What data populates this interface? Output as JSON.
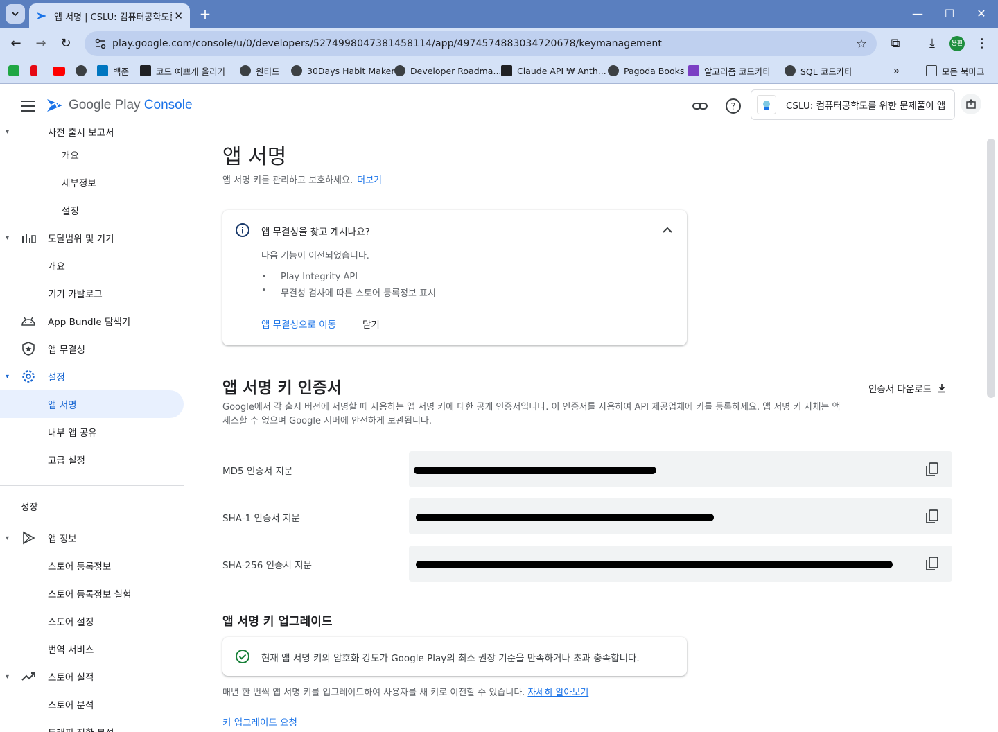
{
  "browser": {
    "tab_title": "앱 서명 | CSLU: 컴퓨터공학도를",
    "url": "play.google.com/console/u/0/developers/5274998047381458114/app/4974574883034720678/keymanagement",
    "profile_label": "용환",
    "bookmarks": [
      {
        "label": "",
        "icon_color": "#20a744"
      },
      {
        "label": "",
        "icon_color": "#e50914"
      },
      {
        "label": "",
        "icon_color": "#ff0000"
      },
      {
        "label": "",
        "icon_color": "#3c4043"
      },
      {
        "label": "백준",
        "icon_color": "#0076c0"
      },
      {
        "label": "코드 예쁘게 올리기",
        "icon_color": "#202124"
      },
      {
        "label": "원티드",
        "icon_color": "#3c4043"
      },
      {
        "label": "30Days Habit Maker",
        "icon_color": "#3c4043"
      },
      {
        "label": "Developer Roadma...",
        "icon_color": "#3c4043"
      },
      {
        "label": "Claude API ₩ Anth...",
        "icon_color": "#202124"
      },
      {
        "label": "Pagoda Books",
        "icon_color": "#3c4043"
      },
      {
        "label": "알고리즘 코드카타",
        "icon_color": "#7b3fc4"
      },
      {
        "label": "SQL 코드카타",
        "icon_color": "#3c4043"
      }
    ],
    "all_bookmarks": "모든 북마크"
  },
  "header": {
    "brand_google_play": "Google Play",
    "brand_console": "Console",
    "app_name": "CSLU: 컴퓨터공학도를 위한 문제풀이 앱"
  },
  "sidebar": {
    "partial_top": "사전 출시 보고서",
    "items": [
      {
        "label": "개요",
        "level": 2
      },
      {
        "label": "세부정보",
        "level": 2
      },
      {
        "label": "설정",
        "level": 2
      },
      {
        "label": "도달범위 및 기기",
        "level": 1,
        "icon": "bar-chart-icon"
      },
      {
        "label": "개요",
        "level": 2
      },
      {
        "label": "기기 카탈로그",
        "level": 2
      },
      {
        "label": "App Bundle 탐색기",
        "level": 1,
        "icon": "android-icon"
      },
      {
        "label": "앱 무결성",
        "level": 1,
        "icon": "shield-icon"
      },
      {
        "label": "설정",
        "level": 1,
        "icon": "gear-icon"
      },
      {
        "label": "앱 서명",
        "level": 2
      },
      {
        "label": "내부 앱 공유",
        "level": 2
      },
      {
        "label": "고급 설정",
        "level": 2
      }
    ],
    "section_growth": "성장",
    "growth_items": [
      {
        "label": "앱 정보",
        "icon": "play-icon"
      },
      {
        "label": "스토어 등록정보"
      },
      {
        "label": "스토어 등록정보 실험"
      },
      {
        "label": "스토어 설정"
      },
      {
        "label": "번역 서비스"
      },
      {
        "label": "스토어 실적",
        "icon": "trending-icon"
      },
      {
        "label": "스토어 분석"
      },
      {
        "label": "트래픽 전환 분석"
      }
    ]
  },
  "main": {
    "title": "앱 서명",
    "subtitle": "앱 서명 키를 관리하고 보호하세요.",
    "learn_more": "더보기",
    "info_card": {
      "title": "앱 무결성을 찾고 계시나요?",
      "body": "다음 기능이 이전되었습니다.",
      "bullets": [
        "Play Integrity API",
        "무결성 검사에 따른 스토어 등록정보 표시"
      ],
      "action_primary": "앱 무결성으로 이동",
      "action_close": "닫기"
    },
    "cert_section": {
      "title": "앱 서명 키 인증서",
      "download": "인증서 다운로드",
      "description": "Google에서 각 출시 버전에 서명할 때 사용하는 앱 서명 키에 대한 공개 인증서입니다. 이 인증서를 사용하여 API 제공업체에 키를 등록하세요. 앱 서명 키 자체는 액세스할 수 없으며 Google 서버에 안전하게 보관됩니다.",
      "fingerprints": [
        {
          "label": "MD5 인증서 지문"
        },
        {
          "label": "SHA-1 인증서 지문"
        },
        {
          "label": "SHA-256 인증서 지문"
        }
      ]
    },
    "upgrade_section": {
      "title": "앱 서명 키 업그레이드",
      "status": "현재 앱 서명 키의 암호화 강도가 Google Play의 최소 권장 기준을 만족하거나 초과 충족합니다.",
      "description": "매년 한 번씩 앱 서명 키를 업그레이드하여 사용자를 새 키로 이전할 수 있습니다.",
      "learn_more": "자세히 알아보기",
      "request": "키 업그레이드 요청"
    }
  },
  "colors": {
    "accent": "#1a73e8",
    "active_nav_bg": "#e8f0fe",
    "success": "#188038",
    "chrome_frame": "#5a7fbf"
  }
}
